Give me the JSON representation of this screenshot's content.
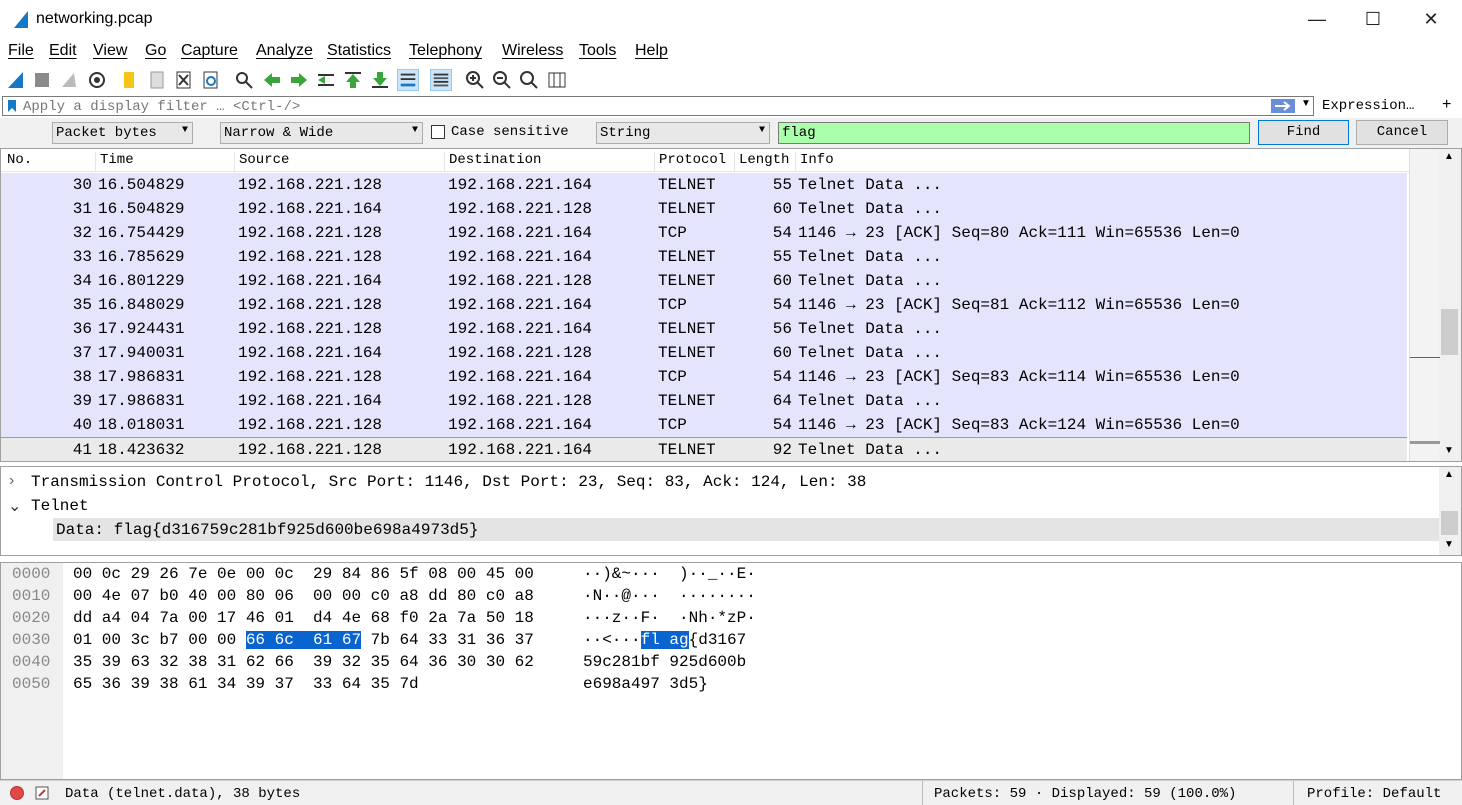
{
  "window": {
    "title": "networking.pcap",
    "minimize": "—",
    "maximize": "☐",
    "close": "✕"
  },
  "menu": [
    "File",
    "Edit",
    "View",
    "Go",
    "Capture",
    "Analyze",
    "Statistics",
    "Telephony",
    "Wireless",
    "Tools",
    "Help"
  ],
  "toolbar_icons": [
    "shark-fin-start-icon",
    "stop-icon",
    "restart-icon",
    "capture-options-icon",
    "open-file-icon",
    "save-file-icon",
    "close-file-icon",
    "reload-icon",
    "find-icon",
    "back-icon",
    "forward-icon",
    "go-to-packet-icon",
    "first-packet-icon",
    "last-packet-icon",
    "autoscroll-icon",
    "colorize-icon",
    "zoom-in-icon",
    "zoom-out-icon",
    "zoom-normal-icon",
    "resize-columns-icon"
  ],
  "filter": {
    "placeholder": "Apply a display filter … <Ctrl-/>",
    "expression_label": "Expression…",
    "add_label": "+"
  },
  "find": {
    "search_in": "Packet bytes",
    "charset": "Narrow & Wide",
    "case_sensitive_label": "Case sensitive",
    "type": "String",
    "value": "flag",
    "find_label": "Find",
    "cancel_label": "Cancel"
  },
  "packet_list": {
    "columns": [
      "No.",
      "Time",
      "Source",
      "Destination",
      "Protocol",
      "Length",
      "Info"
    ],
    "rows": [
      {
        "no": "30",
        "time": "16.504829",
        "src": "192.168.221.128",
        "dst": "192.168.221.164",
        "proto": "TELNET",
        "len": "55",
        "info": "Telnet Data ..."
      },
      {
        "no": "31",
        "time": "16.504829",
        "src": "192.168.221.164",
        "dst": "192.168.221.128",
        "proto": "TELNET",
        "len": "60",
        "info": "Telnet Data ..."
      },
      {
        "no": "32",
        "time": "16.754429",
        "src": "192.168.221.128",
        "dst": "192.168.221.164",
        "proto": "TCP",
        "len": "54",
        "info": "1146 → 23 [ACK] Seq=80 Ack=111 Win=65536 Len=0"
      },
      {
        "no": "33",
        "time": "16.785629",
        "src": "192.168.221.128",
        "dst": "192.168.221.164",
        "proto": "TELNET",
        "len": "55",
        "info": "Telnet Data ..."
      },
      {
        "no": "34",
        "time": "16.801229",
        "src": "192.168.221.164",
        "dst": "192.168.221.128",
        "proto": "TELNET",
        "len": "60",
        "info": "Telnet Data ..."
      },
      {
        "no": "35",
        "time": "16.848029",
        "src": "192.168.221.128",
        "dst": "192.168.221.164",
        "proto": "TCP",
        "len": "54",
        "info": "1146 → 23 [ACK] Seq=81 Ack=112 Win=65536 Len=0"
      },
      {
        "no": "36",
        "time": "17.924431",
        "src": "192.168.221.128",
        "dst": "192.168.221.164",
        "proto": "TELNET",
        "len": "56",
        "info": "Telnet Data ..."
      },
      {
        "no": "37",
        "time": "17.940031",
        "src": "192.168.221.164",
        "dst": "192.168.221.128",
        "proto": "TELNET",
        "len": "60",
        "info": "Telnet Data ..."
      },
      {
        "no": "38",
        "time": "17.986831",
        "src": "192.168.221.128",
        "dst": "192.168.221.164",
        "proto": "TCP",
        "len": "54",
        "info": "1146 → 23 [ACK] Seq=83 Ack=114 Win=65536 Len=0"
      },
      {
        "no": "39",
        "time": "17.986831",
        "src": "192.168.221.164",
        "dst": "192.168.221.128",
        "proto": "TELNET",
        "len": "64",
        "info": "Telnet Data ..."
      },
      {
        "no": "40",
        "time": "18.018031",
        "src": "192.168.221.128",
        "dst": "192.168.221.164",
        "proto": "TCP",
        "len": "54",
        "info": "1146 → 23 [ACK] Seq=83 Ack=124 Win=65536 Len=0"
      },
      {
        "no": "41",
        "time": "18.423632",
        "src": "192.168.221.128",
        "dst": "192.168.221.164",
        "proto": "TELNET",
        "len": "92",
        "info": "Telnet Data ..."
      }
    ]
  },
  "details": {
    "tcp": "Transmission Control Protocol, Src Port: 1146, Dst Port: 23, Seq: 83, Ack: 124, Len: 38",
    "telnet": "Telnet",
    "data": "Data: flag{d316759c281bf925d600be698a4973d5}"
  },
  "bytes": {
    "rows": [
      {
        "off": "0000",
        "hex_a": "00 0c 29 26 7e 0e 00 0c  29 84 86 5f 08 00 45 00",
        "hex_hl": "",
        "hex_b": "",
        "asc_a": "··)&~···  )··_··E·",
        "asc_hl": "",
        "asc_b": ""
      },
      {
        "off": "0010",
        "hex_a": "00 4e 07 b0 40 00 80 06  00 00 c0 a8 dd 80 c0 a8",
        "hex_hl": "",
        "hex_b": "",
        "asc_a": "·N··@···  ········",
        "asc_hl": "",
        "asc_b": ""
      },
      {
        "off": "0020",
        "hex_a": "dd a4 04 7a 00 17 46 01  d4 4e 68 f0 2a 7a 50 18",
        "hex_hl": "",
        "hex_b": "",
        "asc_a": "···z··F·  ·Nh·*zP·",
        "asc_hl": "",
        "asc_b": ""
      },
      {
        "off": "0030",
        "hex_a": "01 00 3c b7 00 00 ",
        "hex_hl": "66 6c  61 67",
        "hex_b": " 7b 64 33 31 36 37",
        "asc_a": "··<···",
        "asc_hl": "fl ag",
        "asc_b": "{d3167"
      },
      {
        "off": "0040",
        "hex_a": "35 39 63 32 38 31 62 66  39 32 35 64 36 30 30 62",
        "hex_hl": "",
        "hex_b": "",
        "asc_a": "59c281bf 925d600b",
        "asc_hl": "",
        "asc_b": ""
      },
      {
        "off": "0050",
        "hex_a": "65 36 39 38 61 34 39 37  33 64 35 7d",
        "hex_hl": "",
        "hex_b": "",
        "asc_a": "e698a497 3d5}",
        "asc_hl": "",
        "asc_b": ""
      }
    ]
  },
  "status": {
    "field": "Data (telnet.data), 38 bytes",
    "packets": "Packets: 59 · Displayed: 59 (100.0%)",
    "profile": "Profile: Default"
  }
}
